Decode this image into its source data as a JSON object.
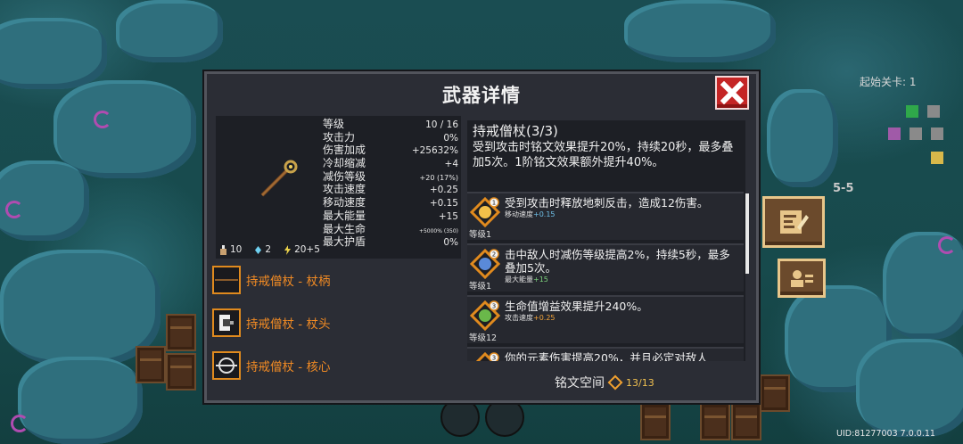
{
  "dialog": {
    "title": "武器详情",
    "stats": [
      {
        "name": "等级",
        "value": "10 / 16",
        "size": "normal"
      },
      {
        "name": "攻击力",
        "value": "0%",
        "size": "normal"
      },
      {
        "name": "伤害加成",
        "value": "+25632%",
        "size": "normal"
      },
      {
        "name": "冷却缩减",
        "value": "+4",
        "size": "normal"
      },
      {
        "name": "减伤等级",
        "value": "+20 (17%)",
        "size": "small"
      },
      {
        "name": "攻击速度",
        "value": "+0.25",
        "size": "normal"
      },
      {
        "name": "移动速度",
        "value": "+0.15",
        "size": "normal"
      },
      {
        "name": "最大能量",
        "value": "+15",
        "size": "normal"
      },
      {
        "name": "最大生命",
        "value": "+5000% (350)",
        "size": "tiny"
      },
      {
        "name": "最大护盾",
        "value": "0%",
        "size": "normal"
      }
    ],
    "resources": {
      "a": "10",
      "b": "2",
      "c": "20+5"
    },
    "parts": [
      {
        "label": "持戒僧杖 - 杖柄",
        "icon": "staff-handle-icon"
      },
      {
        "label": "持戒僧杖 - 杖头",
        "icon": "staff-head-icon"
      },
      {
        "label": "持戒僧杖 - 核心",
        "icon": "staff-core-icon"
      }
    ],
    "weapon": {
      "title": "持戒僧杖(3/3)",
      "desc": "受到攻击时铭文效果提升20%，持续20秒，最多叠加5次。1阶铭文效果额外提升40%。"
    },
    "inscriptions": [
      {
        "num": "1",
        "level": "等级1",
        "desc": "受到攻击时释放地刺反击，造成12伤害。",
        "bonus_name": "移动速度",
        "bonus_value": "+0.15",
        "bonus_color": "#6fc0e8"
      },
      {
        "num": "2",
        "level": "等级1",
        "desc": "击中敌人时减伤等级提高2%，持续5秒，最多叠加5次。",
        "bonus_name": "最大能量",
        "bonus_value": "+15",
        "bonus_color": "#7dd37d"
      },
      {
        "num": "3",
        "level": "等级12",
        "desc": "生命值增益效果提升240%。",
        "bonus_name": "攻击速度",
        "bonus_value": "+0.25",
        "bonus_color": "#f2a33a"
      },
      {
        "num": "3",
        "level": "",
        "desc": "你的元素伤害提高20%，并且必定对敌人",
        "bonus_name": "",
        "bonus_value": "",
        "bonus_color": "#e0e0e0"
      }
    ],
    "slot": {
      "label": "铭文空间",
      "count": "13/13"
    }
  },
  "hud": {
    "stage_label": "起始关卡: 1",
    "stage_num": "5-5",
    "uid": "UID:81277003 7.0.0.11"
  },
  "colors": {
    "accent": "#f08a24",
    "close": "#c42525",
    "panel": "#2b2d35"
  }
}
